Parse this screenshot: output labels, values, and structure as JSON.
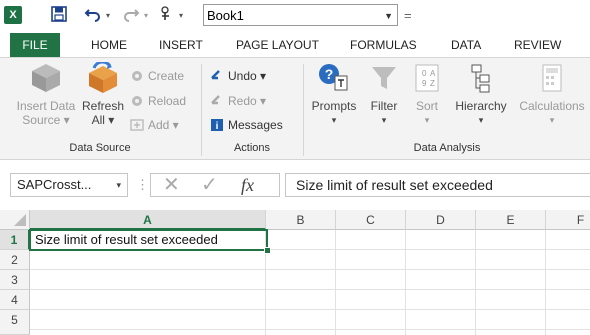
{
  "quick_access": {
    "app_logo": "X",
    "save_icon": "save-icon",
    "undo_icon": "undo-icon",
    "redo_icon": "redo-icon",
    "touch_icon": "touch-mode-icon",
    "book_name": "Book1",
    "customize_glyph": "="
  },
  "tabs": [
    {
      "label": "FILE",
      "active": true
    },
    {
      "label": "HOME"
    },
    {
      "label": "INSERT"
    },
    {
      "label": "PAGE LAYOUT"
    },
    {
      "label": "FORMULAS"
    },
    {
      "label": "DATA"
    },
    {
      "label": "REVIEW"
    }
  ],
  "ribbon": {
    "data_source": {
      "group_label": "Data Source",
      "insert_data": [
        "Insert Data",
        "Source ▾"
      ],
      "refresh": [
        "Refresh",
        "All ▾"
      ],
      "create": "Create",
      "reload": "Reload",
      "add": "Add ▾"
    },
    "actions": {
      "group_label": "Actions",
      "undo": "Undo ▾",
      "redo": "Redo ▾",
      "messages": "Messages"
    },
    "data_analysis": {
      "group_label": "Data Analysis",
      "prompts": "Prompts",
      "filter": "Filter",
      "sort": "Sort",
      "hierarchy": "Hierarchy",
      "calculations": "Calculations",
      "dropdown_glyph": "▾"
    }
  },
  "formula_bar": {
    "name_box": "SAPCrosst...",
    "dropdown_glyph": "▾",
    "colon_glyph": "⋮",
    "cancel_glyph": "✕",
    "enter_glyph": "✓",
    "fx_glyph": "fx",
    "formula": "Size limit of result set exceeded"
  },
  "grid": {
    "columns": [
      "A",
      "B",
      "C",
      "D",
      "E",
      "F"
    ],
    "rows": [
      "1",
      "2",
      "3",
      "4",
      "5"
    ],
    "a1": "Size limit of result set exceeded"
  },
  "colors": {
    "excel_green": "#217346",
    "ribbon_bg": "#f3f3f3"
  }
}
